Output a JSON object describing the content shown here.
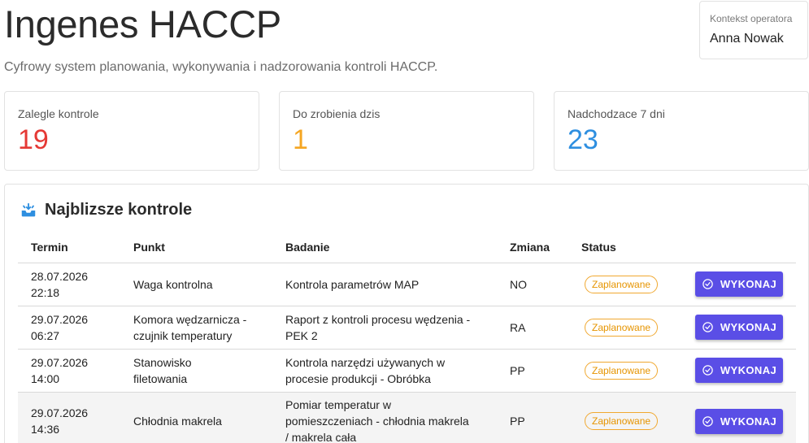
{
  "app": {
    "title": "Ingenes HACCP",
    "subtitle": "Cyfrowy system planowania, wykonywania i nadzorowania kontroli HACCP."
  },
  "operator": {
    "label": "Kontekst operatora",
    "name": "Anna Nowak"
  },
  "stats": [
    {
      "label": "Zalegle kontrole",
      "value": "19",
      "color": "#e53935"
    },
    {
      "label": "Do zrobienia dzis",
      "value": "1",
      "color": "#f5a623"
    },
    {
      "label": "Nadchodzace 7 dni",
      "value": "23",
      "color": "#2e8fe0"
    }
  ],
  "panel": {
    "title": "Najblizsze kontrole",
    "icon": "inbox-tray-icon",
    "columns": [
      "Termin",
      "Punkt",
      "Badanie",
      "Zmiana",
      "Status"
    ],
    "rows": [
      {
        "date": "28.07.2026",
        "time": "22:18",
        "punkt": [
          "Waga kontrolna"
        ],
        "badanie": [
          "Kontrola parametrów MAP"
        ],
        "zmiana": "NO",
        "status": "Zaplanowane",
        "action": "WYKONAJ"
      },
      {
        "date": "29.07.2026",
        "time": "06:27",
        "punkt": [
          "Komora wędzarnicza -",
          "czujnik temperatury"
        ],
        "badanie": [
          "Raport z kontroli procesu wędzenia -",
          "PEK 2"
        ],
        "zmiana": "RA",
        "status": "Zaplanowane",
        "action": "WYKONAJ"
      },
      {
        "date": "29.07.2026",
        "time": "14:00",
        "punkt": [
          "Stanowisko",
          "filetowania"
        ],
        "badanie": [
          "Kontrola narzędzi używanych w",
          "procesie produkcji - Obróbka"
        ],
        "zmiana": "PP",
        "status": "Zaplanowane",
        "action": "WYKONAJ"
      },
      {
        "date": "29.07.2026",
        "time": "14:36",
        "punkt": [
          "Chłodnia makrela"
        ],
        "badanie": [
          "Pomiar temperatur w",
          "pomieszczeniach - chłodnia makrela",
          "/ makrela cała"
        ],
        "zmiana": "PP",
        "status": "Zaplanowane",
        "action": "WYKONAJ"
      }
    ]
  },
  "colors": {
    "accent": "#5a4ee6",
    "badge": "#f0a830",
    "overdue": "#e53935",
    "today": "#f5a623",
    "upcoming": "#2e8fe0"
  }
}
